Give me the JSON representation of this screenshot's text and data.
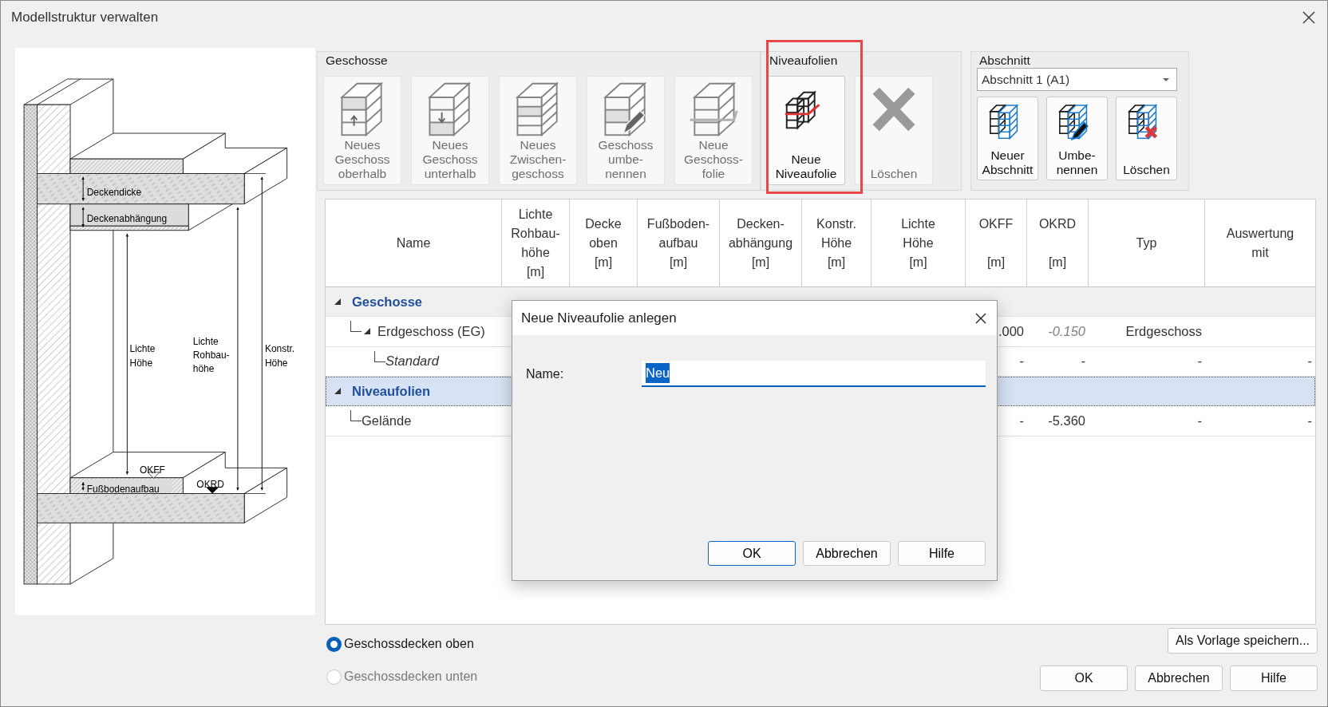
{
  "window": {
    "title": "Modellstruktur verwalten"
  },
  "diagram": {
    "labels": [
      "Deckendicke",
      "Deckenabhängung",
      "Lichte\nHöhe",
      "Lichte\nRohbau-\nhöhe",
      "Konstr.\nHöhe",
      "OKFF",
      "OKRD",
      "Fußbodenaufbau"
    ]
  },
  "toolbar": [
    {
      "title": "Geschosse",
      "highlighted": false,
      "buttons": [
        {
          "label": "Neues\nGeschoss\noberhalb",
          "disabled": true
        },
        {
          "label": "Neues\nGeschoss\nunterhalb",
          "disabled": true
        },
        {
          "label": "Neues\nZwischen-\ngeschoss",
          "disabled": true
        },
        {
          "label": "Geschoss\numbe-\nnennen",
          "disabled": true
        },
        {
          "label": "Neue\nGeschoss-\nfolie",
          "disabled": true
        }
      ]
    },
    {
      "title": "Niveaufolien",
      "highlighted": true,
      "buttons": [
        {
          "label": "Neue\nNiveaufolie",
          "disabled": false
        },
        {
          "label": "Löschen",
          "disabled": true
        }
      ]
    },
    {
      "title": "Abschnitt",
      "highlighted": false,
      "dropdown": {
        "value": "Abschnitt 1 (A1)"
      },
      "buttons": [
        {
          "label": "Neuer\nAbschnitt",
          "disabled": false
        },
        {
          "label": "Umbe-\nnennen",
          "disabled": false
        },
        {
          "label": "Löschen",
          "disabled": false
        }
      ]
    }
  ],
  "table": {
    "columns": [
      "Name",
      "Lichte\nRohbau-\nhöhe\n[m]",
      "Decke\noben\n[m]",
      "Fußboden-\naufbau\n[m]",
      "Decken-\nabhängung\n[m]",
      "Konstr.\nHöhe\n[m]",
      "Lichte\nHöhe\n[m]",
      "OKFF\n\n[m]",
      "OKRD\n\n[m]",
      "Typ",
      "Auswertung\nmit"
    ],
    "groups": [
      {
        "label": "Geschosse",
        "expanded": true,
        "selected": false,
        "children": [
          {
            "label": "Erdgeschoss (EG)",
            "italic": false,
            "expanded": true,
            "cells": [
              {
                "text": ".000",
                "muted": false
              },
              {
                "text": "-0.150",
                "muted": true
              },
              {
                "text": "Erdgeschoss",
                "muted": false
              }
            ],
            "children": [
              {
                "label": "Standard",
                "italic": true,
                "cells": [
                  {
                    "text": "-",
                    "muted": false
                  },
                  {
                    "text": "-",
                    "muted": false
                  },
                  {
                    "text": "-",
                    "muted": false
                  },
                  {
                    "text": "-",
                    "muted": false
                  }
                ]
              }
            ]
          }
        ]
      },
      {
        "label": "Niveaufolien",
        "expanded": true,
        "selected": true,
        "children": [
          {
            "label": "Gelände",
            "italic": false,
            "cells": [
              {
                "text": "-",
                "muted": false
              },
              {
                "text": "-5.360",
                "muted": false
              },
              {
                "text": "-",
                "muted": false
              },
              {
                "text": "-",
                "muted": false
              }
            ]
          }
        ]
      }
    ]
  },
  "dialog": {
    "title": "Neue Niveaufolie anlegen",
    "field": {
      "label": "Name:",
      "value": "Neu"
    },
    "buttons": [
      "OK",
      "Abbrechen",
      "Hilfe"
    ]
  },
  "options": [
    {
      "label": "Geschossdecken oben",
      "selected": true,
      "disabled": false
    },
    {
      "label": "Geschossdecken unten",
      "selected": false,
      "disabled": true
    }
  ],
  "save_template_button": "Als Vorlage speichern...",
  "buttons": [
    "OK",
    "Abbrechen",
    "Hilfe"
  ]
}
